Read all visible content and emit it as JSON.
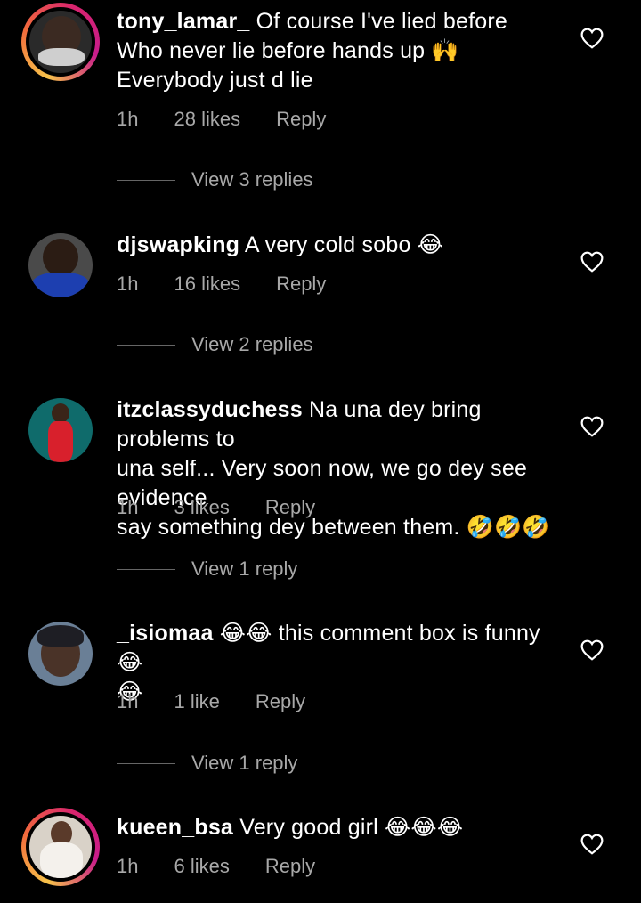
{
  "comments": [
    {
      "username": "tony_lamar_",
      "text_lines": [
        "Of course I've lied before",
        "Who never lie before hands up 🙌",
        "Everybody just d lie"
      ],
      "time": "1h",
      "likes": "28 likes",
      "reply": "Reply",
      "view_replies": "View 3 replies",
      "has_story": true,
      "avatar_color": "#2a2a2a"
    },
    {
      "username": "djswapking",
      "text_lines": [
        "A very cold sobo 😂"
      ],
      "time": "1h",
      "likes": "16 likes",
      "reply": "Reply",
      "view_replies": "View 2 replies",
      "has_story": false,
      "avatar_color": "#1d3fb0"
    },
    {
      "username": "itzclassyduchess",
      "text_lines": [
        "Na una dey bring problems to",
        "una self... Very soon now, we go dey see evidence",
        "say something dey between them. 🤣🤣🤣"
      ],
      "time": "1h",
      "likes": "3 likes",
      "reply": "Reply",
      "view_replies": "View 1 reply",
      "has_story": false,
      "avatar_color": "#0f6b6b"
    },
    {
      "username": "_isiomaa",
      "text_lines": [
        "😂😂 this comment box is funny 😂",
        "😂"
      ],
      "time": "1h",
      "likes": "1 like",
      "reply": "Reply",
      "view_replies": "View 1 reply",
      "has_story": false,
      "avatar_color": "#6a7f96"
    },
    {
      "username": "kueen_bsa",
      "text_lines": [
        "Very good girl 😂😂😂"
      ],
      "time": "1h",
      "likes": "6 likes",
      "reply": "Reply",
      "has_story": true,
      "avatar_color": "#d9d2c8"
    }
  ],
  "icons": {
    "like": "heart-outline-icon"
  }
}
